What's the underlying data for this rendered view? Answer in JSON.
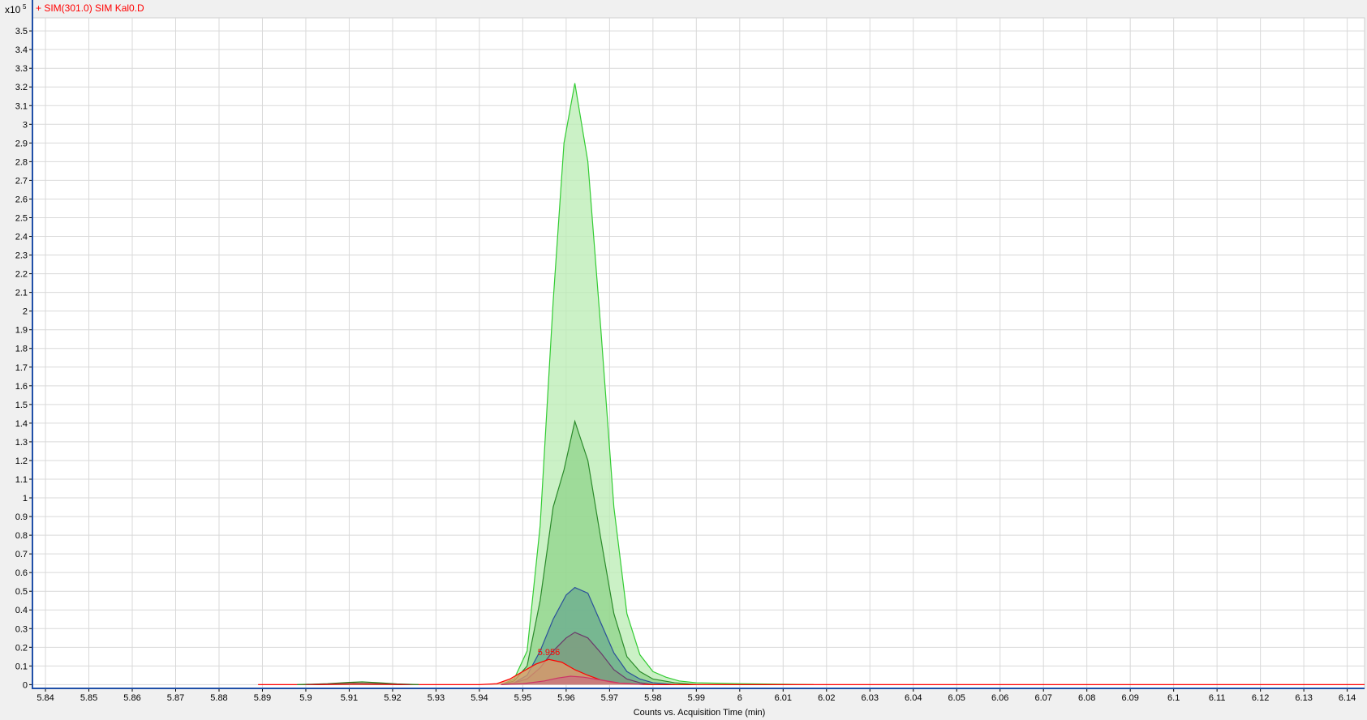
{
  "chart_data": {
    "type": "area",
    "title": "+ SIM(301.0) SIM Kal0.D",
    "y_multiplier": "x10",
    "y_multiplier_exp": "5",
    "xlabel": "Counts vs. Acquisition Time (min)",
    "ylabel": "",
    "xlim": [
      5.837,
      6.144
    ],
    "ylim": [
      -0.02,
      3.57
    ],
    "x_ticks": [
      "5.84",
      "5.85",
      "5.86",
      "5.87",
      "5.88",
      "5.89",
      "5.9",
      "5.91",
      "5.92",
      "5.93",
      "5.94",
      "5.95",
      "5.96",
      "5.97",
      "5.98",
      "5.99",
      "6",
      "6.01",
      "6.02",
      "6.03",
      "6.04",
      "6.05",
      "6.06",
      "6.07",
      "6.08",
      "6.09",
      "6.1",
      "6.11",
      "6.12",
      "6.13",
      "6.14"
    ],
    "y_ticks": [
      "0",
      "0.1",
      "0.2",
      "0.3",
      "0.4",
      "0.5",
      "0.6",
      "0.7",
      "0.8",
      "0.9",
      "1",
      "1.1",
      "1.2",
      "1.3",
      "1.4",
      "1.5",
      "1.6",
      "1.7",
      "1.8",
      "1.9",
      "2",
      "2.1",
      "2.2",
      "2.3",
      "2.4",
      "2.5",
      "2.6",
      "2.7",
      "2.8",
      "2.9",
      "3",
      "3.1",
      "3.2",
      "3.3",
      "3.4",
      "3.5"
    ],
    "grid": true,
    "peak_annotation": {
      "label": "5.956",
      "x": 5.956,
      "y": 0.14
    },
    "series": [
      {
        "color": "#33cc33",
        "fill": "#b9ecb3",
        "x": [
          5.945,
          5.948,
          5.951,
          5.954,
          5.957,
          5.9595,
          5.962,
          5.965,
          5.968,
          5.971,
          5.974,
          5.977,
          5.98,
          5.983,
          5.986,
          5.99,
          6.0,
          6.017
        ],
        "y": [
          0.0,
          0.03,
          0.18,
          0.85,
          2.05,
          2.9,
          3.22,
          2.8,
          1.9,
          0.95,
          0.38,
          0.16,
          0.07,
          0.04,
          0.02,
          0.01,
          0.005,
          0.0
        ]
      },
      {
        "color": "#2a8a2a",
        "fill": "#8fd38a",
        "x": [
          5.945,
          5.948,
          5.951,
          5.954,
          5.957,
          5.9595,
          5.962,
          5.965,
          5.968,
          5.971,
          5.974,
          5.977,
          5.98,
          5.985,
          5.99
        ],
        "y": [
          0.0,
          0.02,
          0.1,
          0.45,
          0.95,
          1.15,
          1.41,
          1.2,
          0.78,
          0.38,
          0.15,
          0.07,
          0.03,
          0.01,
          0.0
        ]
      },
      {
        "color": "#2a4f9a",
        "fill": "#6aab8f",
        "x": [
          5.945,
          5.948,
          5.951,
          5.954,
          5.957,
          5.96,
          5.962,
          5.965,
          5.968,
          5.971,
          5.974,
          5.977,
          5.98,
          5.985
        ],
        "y": [
          0.0,
          0.01,
          0.05,
          0.18,
          0.35,
          0.48,
          0.52,
          0.49,
          0.33,
          0.17,
          0.07,
          0.03,
          0.01,
          0.0
        ]
      },
      {
        "color": "#6b3a6b",
        "fill": "#7f9a7f",
        "x": [
          5.945,
          5.948,
          5.951,
          5.954,
          5.957,
          5.96,
          5.962,
          5.965,
          5.968,
          5.971,
          5.974,
          5.977,
          5.98
        ],
        "y": [
          0.0,
          0.01,
          0.03,
          0.09,
          0.18,
          0.25,
          0.28,
          0.25,
          0.17,
          0.08,
          0.03,
          0.01,
          0.0
        ]
      },
      {
        "color": "#ff0000",
        "fill": "#e39a6a",
        "x": [
          5.889,
          5.94,
          5.944,
          5.947,
          5.95,
          5.953,
          5.956,
          5.959,
          5.962,
          5.965,
          5.968,
          5.971,
          5.975,
          5.98,
          6.144
        ],
        "y": [
          0.0,
          0.0,
          0.005,
          0.03,
          0.07,
          0.11,
          0.135,
          0.12,
          0.08,
          0.05,
          0.025,
          0.01,
          0.003,
          0.0,
          0.0
        ]
      },
      {
        "color": "#cc3366",
        "fill": "#c9727f",
        "x": [
          5.945,
          5.95,
          5.955,
          5.958,
          5.961,
          5.964,
          5.968,
          5.972,
          5.978
        ],
        "y": [
          0.0,
          0.005,
          0.02,
          0.035,
          0.045,
          0.04,
          0.025,
          0.01,
          0.0
        ]
      },
      {
        "color": "#228822",
        "fill": "#9bd49b",
        "x": [
          5.898,
          5.905,
          5.91,
          5.913,
          5.917,
          5.921,
          5.926
        ],
        "y": [
          0.0,
          0.005,
          0.012,
          0.015,
          0.01,
          0.004,
          0.0
        ]
      },
      {
        "color": "#aa2222",
        "fill": "#c88a8a",
        "x": [
          5.9,
          5.906,
          5.911,
          5.915,
          5.92,
          5.924
        ],
        "y": [
          0.0,
          0.004,
          0.008,
          0.006,
          0.003,
          0.0
        ]
      }
    ]
  }
}
